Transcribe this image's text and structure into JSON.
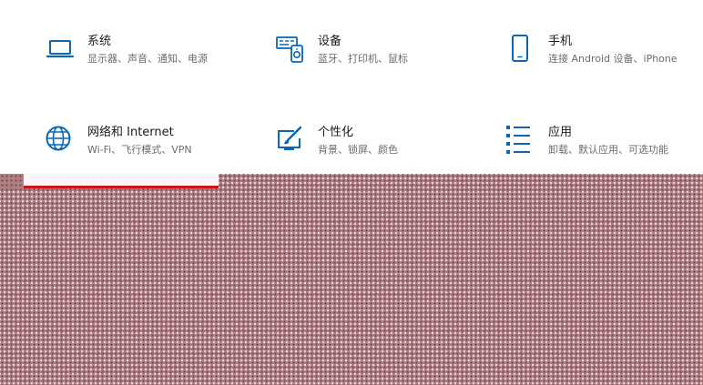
{
  "colors": {
    "accent": "#0a66b3",
    "title_text": "#1a1a1a",
    "desc_text": "#6b6b6b",
    "selection_bar": "#c8141c"
  },
  "tiles": [
    {
      "title": "系统",
      "desc": "显示器、声音、通知、电源",
      "icon": "laptop-icon"
    },
    {
      "title": "设备",
      "desc": "蓝牙、打印机、鼠标",
      "icon": "devices-icon"
    },
    {
      "title": "手机",
      "desc": "连接 Android 设备、iPhone",
      "icon": "phone-icon"
    },
    {
      "title": "网络和 Internet",
      "desc": "Wi-Fi、飞行模式、VPN",
      "icon": "globe-icon"
    },
    {
      "title": "个性化",
      "desc": "背景、锁屏、颜色",
      "icon": "personalization-icon"
    },
    {
      "title": "应用",
      "desc": "卸载、默认应用、可选功能",
      "icon": "apps-list-icon"
    }
  ]
}
